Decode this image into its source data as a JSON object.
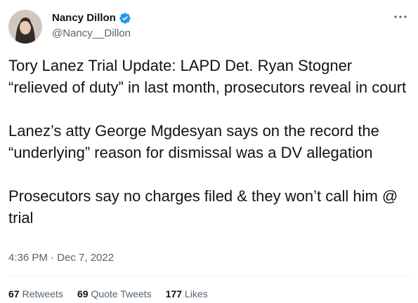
{
  "author": {
    "display_name": "Nancy Dillon",
    "handle": "@Nancy__Dillon",
    "verified": true,
    "verified_icon": "verified-badge-icon",
    "badge_color": "#1d9bf0"
  },
  "tweet": {
    "paragraphs": [
      "Tory Lanez Trial Update: LAPD Det. Ryan Stogner “relieved of duty” in last month, prosecutors reveal in court",
      "Lanez’s atty George Mgdesyan says on the record the “underlying” reason for dismissal was a DV allegation",
      "Prosecutors say no charges filed & they won’t call him @ trial"
    ],
    "timestamp": "4:36 PM · Dec 7, 2022"
  },
  "stats": {
    "retweets_count": "67",
    "retweets_label": "Retweets",
    "quotes_count": "69",
    "quotes_label": "Quote Tweets",
    "likes_count": "177",
    "likes_label": "Likes"
  },
  "menu": {
    "icon": "more-options-icon"
  }
}
